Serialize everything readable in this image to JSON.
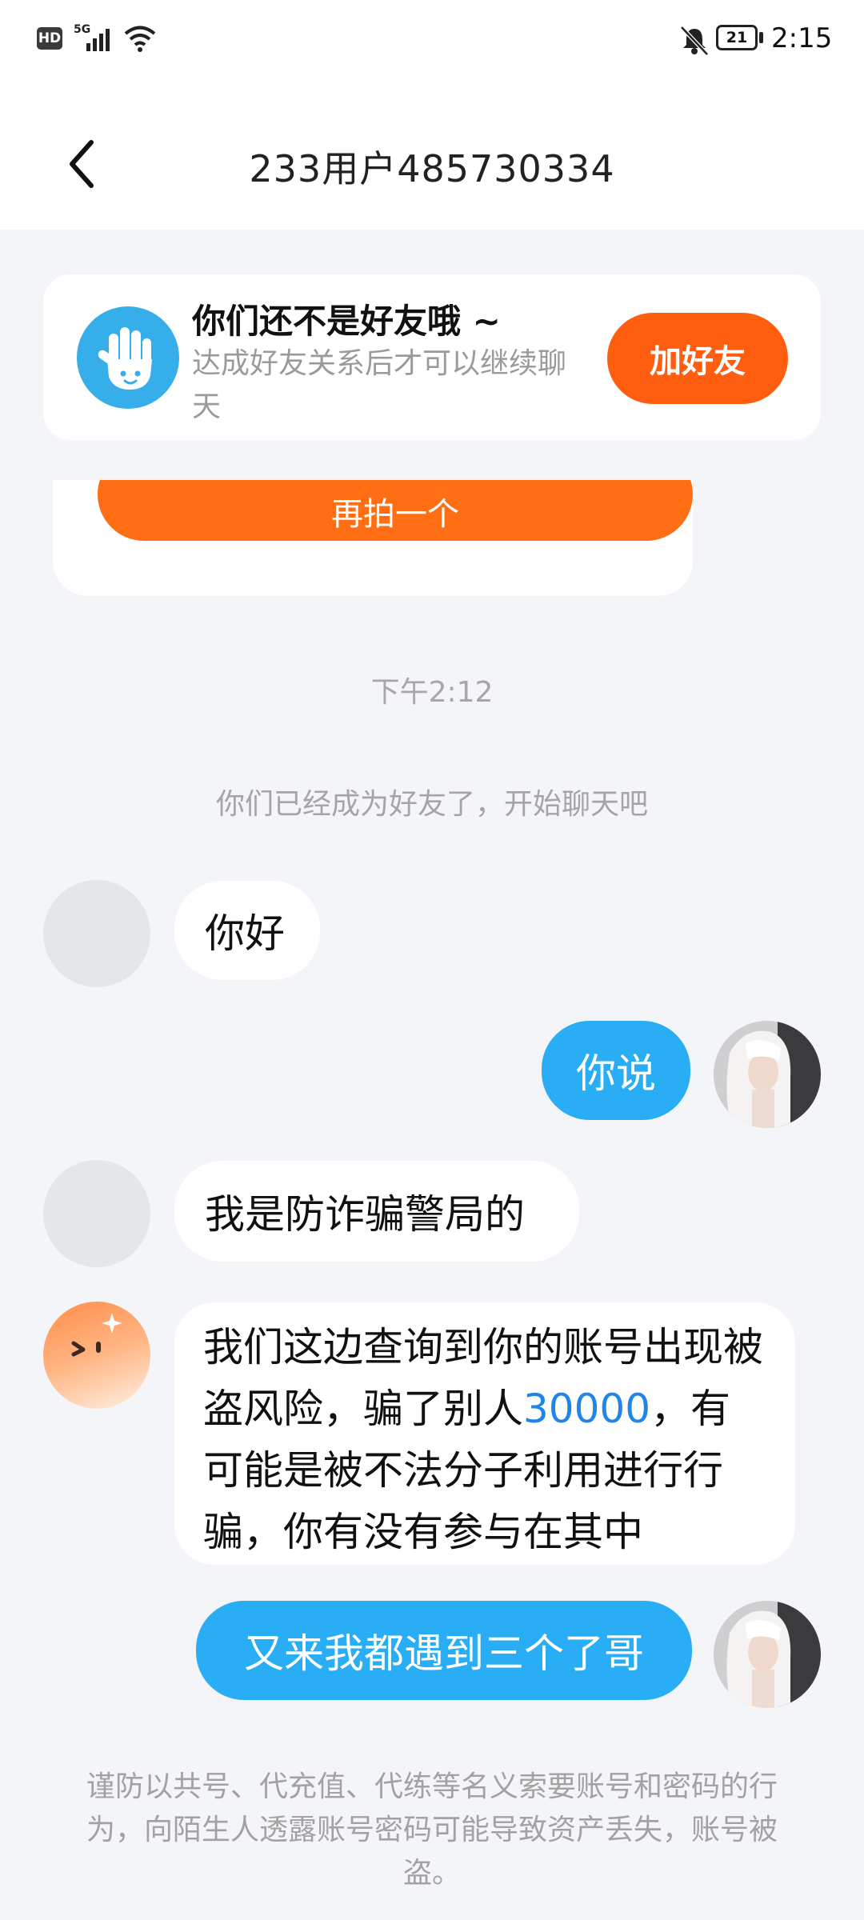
{
  "status_bar": {
    "hd": "HD",
    "network": "5G",
    "battery": "21",
    "time": "2:15"
  },
  "header": {
    "title": "233用户485730334"
  },
  "banner": {
    "title": "你们还不是好友哦 ~",
    "subtitle": "达成好友关系后才可以继续聊天",
    "button": "加好友"
  },
  "cut_card": {
    "button": "再拍一个"
  },
  "timestamp": "下午2:12",
  "system_message": "你们已经成为好友了，开始聊天吧",
  "messages": [
    {
      "from": "them",
      "text": "你好"
    },
    {
      "from": "me",
      "text": "你说"
    },
    {
      "from": "them",
      "text": "我是防诈骗警局的"
    },
    {
      "from": "them",
      "text_before": "我们这边查询到你的账号出现被盗风险，骗了别人",
      "highlight": "30000",
      "text_after": "，有可能是被不法分子利用进行行骗，你有没有参与在其中"
    },
    {
      "from": "me",
      "text": "又来我都遇到三个了哥"
    }
  ],
  "footer_notice": "谨防以共号、代充值、代练等名义索要账号和密码的行为，向陌生人透露账号密码可能导致资产丢失，账号被盗。",
  "colors": {
    "accent_orange": "#ff5e10",
    "bubble_blue": "#29adf5",
    "link_blue": "#1f86e8",
    "background": "#f3f5f8"
  },
  "icons": [
    "back-arrow-icon",
    "hand-wave-icon",
    "signal-icon",
    "wifi-icon",
    "bell-off-icon",
    "battery-icon"
  ]
}
